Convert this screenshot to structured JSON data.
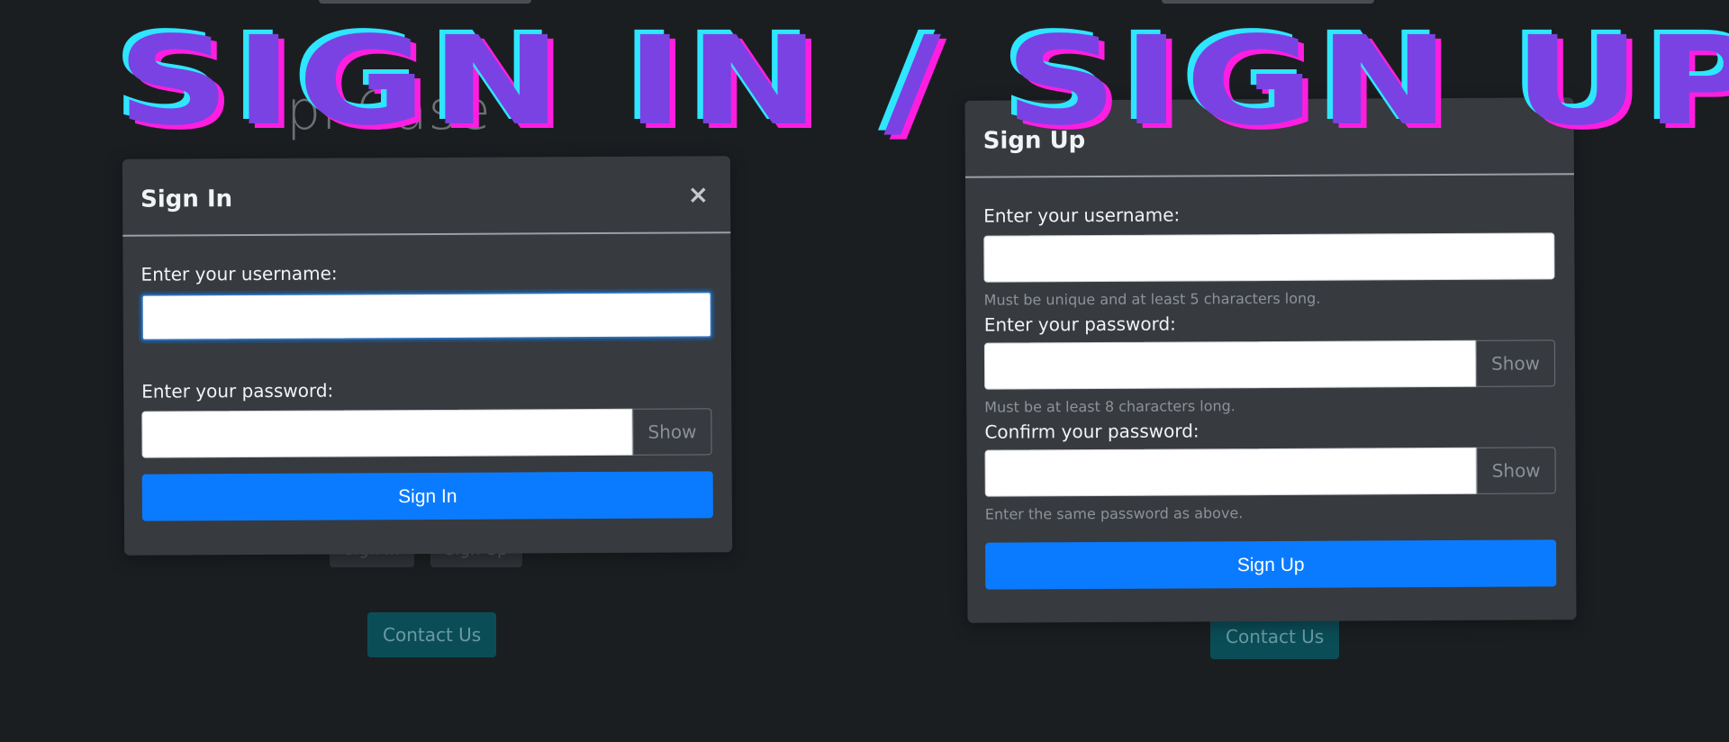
{
  "banner": {
    "title": "SIGN IN / SIGN UP"
  },
  "background": {
    "left_heading": "pl Case",
    "left_signin_button": "Sign In",
    "left_signup_button": "Sign Up",
    "left_contact_button": "Contact Us",
    "right_contact_button": "Contact Us"
  },
  "signin_modal": {
    "title": "Sign In",
    "close_glyph": "×",
    "username_label": "Enter your username:",
    "username_value": "",
    "password_label": "Enter your password:",
    "password_value": "",
    "show_label": "Show",
    "submit_label": "Sign In"
  },
  "signup_modal": {
    "title": "Sign Up",
    "username_label": "Enter your username:",
    "username_value": "",
    "username_help": "Must be unique and at least 5 characters long.",
    "password_label": "Enter your password:",
    "password_value": "",
    "password_help": "Must be at least 8 characters long.",
    "show_label": "Show",
    "confirm_label": "Confirm your password:",
    "confirm_value": "",
    "confirm_help": "Enter the same password as above.",
    "confirm_show_label": "Show",
    "submit_label": "Sign Up"
  },
  "colors": {
    "page_background": "#1b1e21",
    "modal_background": "#373a3f",
    "primary": "#0a7bff",
    "banner_fill": "#7a42e2",
    "banner_cyan": "#2ee6ff",
    "banner_magenta": "#ff1ee0",
    "contact_button": "#0b4d57"
  },
  "icons": {
    "close": "close-icon"
  }
}
